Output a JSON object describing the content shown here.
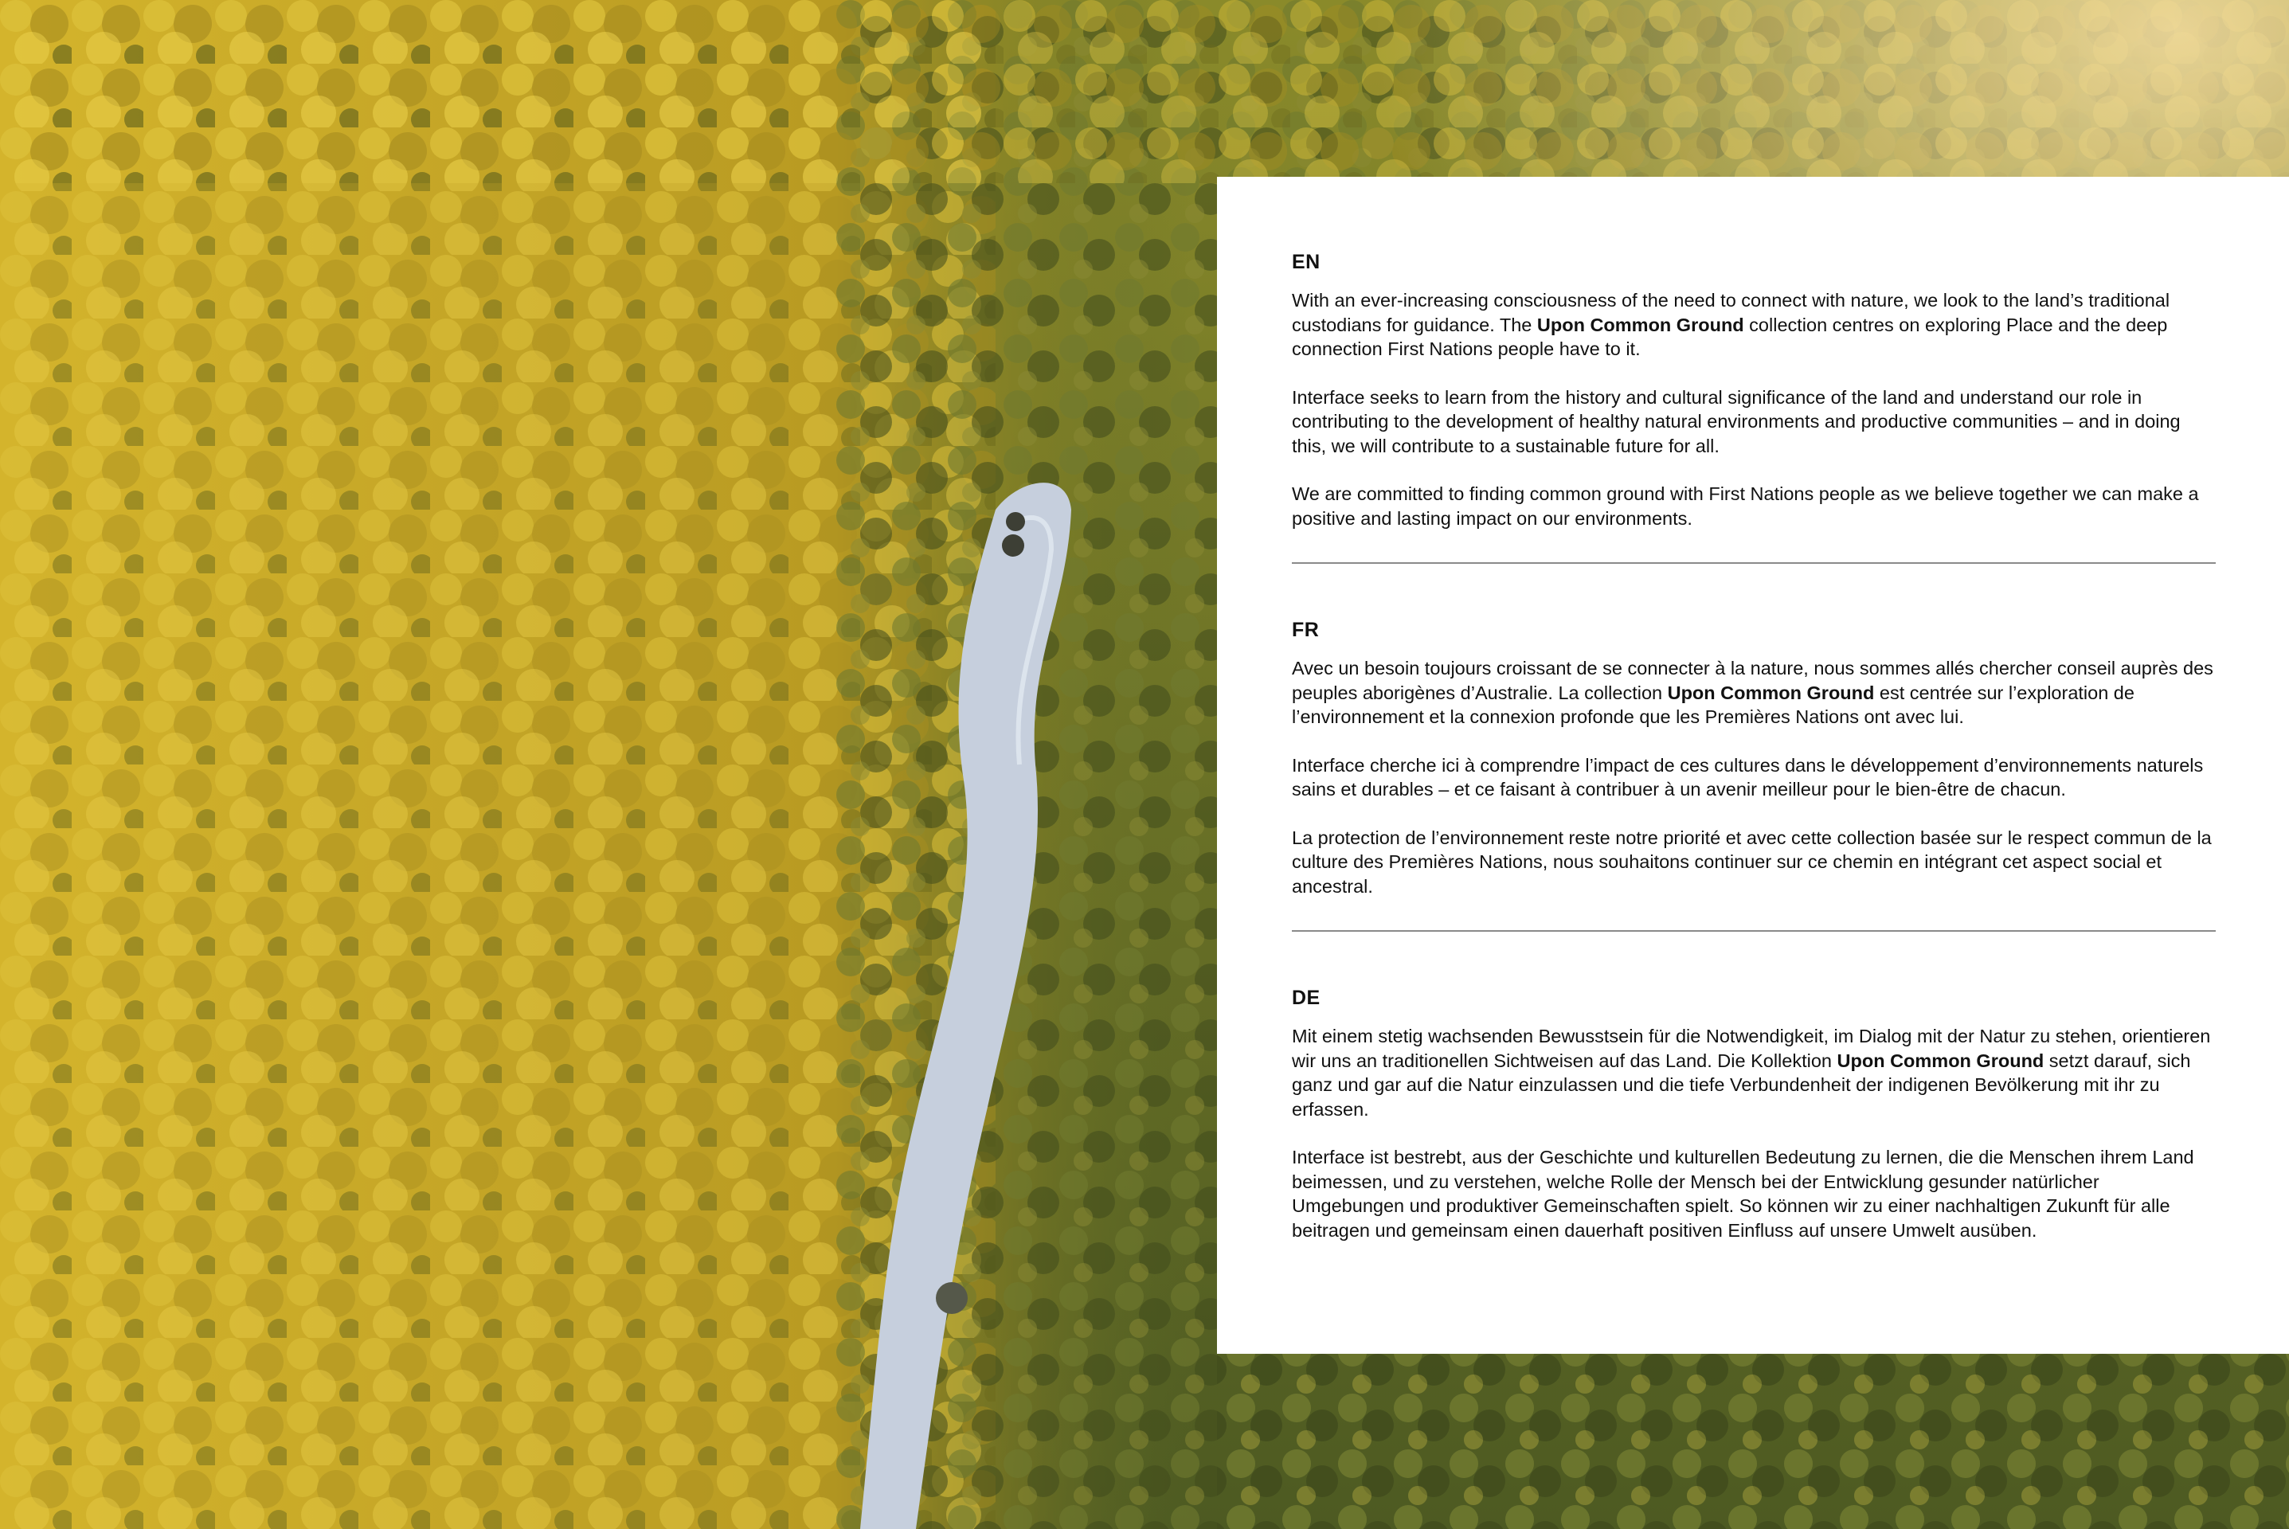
{
  "sections": {
    "en": {
      "code": "EN",
      "p1": {
        "a": "With an ever-increasing consciousness of the need to connect with nature, we look to the land’s traditional custodians for guidance. The ",
        "brand": "Upon Common Ground",
        "b": " collection centres on exploring Place and the deep connection First Nations people have to it."
      },
      "p2": "Interface seeks to learn from the history and cultural significance of the land and understand our role in contributing to the development of healthy natural environments and productive communities – and in doing this, we will contribute to a sustainable future for all.",
      "p3": "We are committed to finding common ground with First Nations people as we believe together we can make a positive and lasting impact on our environments."
    },
    "fr": {
      "code": "FR",
      "p1": {
        "a": "Avec un besoin toujours croissant de se connecter à la nature, nous sommes allés chercher conseil auprès des peuples aborigènes d’Australie. La collection ",
        "brand": "Upon Common Ground",
        "b": " est centrée sur l’exploration de l’environnement et la connexion profonde que les Premières Nations ont avec lui."
      },
      "p2": "Interface cherche ici à comprendre l’impact de ces cultures dans le développement d’environnements naturels sains et durables – et ce faisant à contribuer à un avenir meilleur pour le bien-être de chacun.",
      "p3": "La protection de l’environnement reste notre priorité et avec cette collection basée sur le respect commun de la culture des Premières Nations, nous souhaitons continuer sur ce chemin en intégrant cet aspect social et ancestral."
    },
    "de": {
      "code": "DE",
      "p1": {
        "a": "Mit einem stetig wachsenden Bewusstsein für die Notwendigkeit, im Dialog mit der Natur zu stehen, orientieren wir uns an traditionellen Sichtweisen auf das Land. Die Kollektion ",
        "brand": "Upon Common Ground",
        "b": " setzt darauf, sich ganz und gar auf die Natur einzulassen und die tiefe Verbundenheit der indigenen Bevölkerung mit ihr zu erfassen."
      },
      "p2": "Interface ist bestrebt, aus der Geschichte und kulturellen Bedeutung zu lernen, die die Menschen ihrem Land beimessen, und zu verstehen, welche Rolle der Mensch bei der Entwicklung gesunder natürlicher Umgebungen und produktiver Gemeinschaften spielt. So können wir zu einer nachhaltigen Zukunft für alle beitragen und gemeinsam einen dauerhaft positiven Einfluss auf unsere Umwelt ausüben."
    }
  },
  "colors": {
    "panel": "#ffffff",
    "text": "#111111",
    "rule": "#8a8a8a",
    "forest_light": "#c9a82a",
    "forest_dark": "#4a5a22",
    "river": "#c9d2e0"
  }
}
